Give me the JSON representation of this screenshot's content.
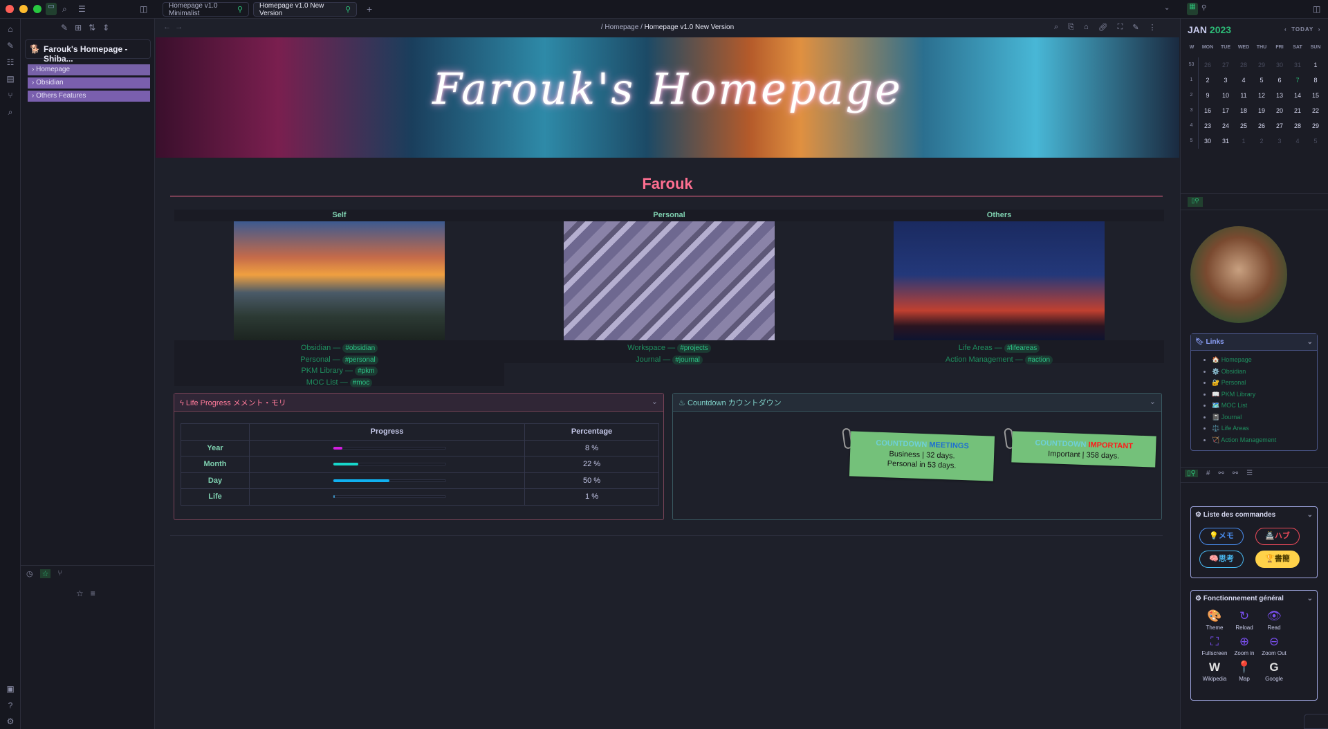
{
  "window": {
    "tabs": [
      {
        "label": "Homepage v1.0 Minimalist"
      },
      {
        "label": "Homepage v1.0 New Version"
      }
    ],
    "new_tab": "+"
  },
  "breadcrumb": {
    "sep": "/",
    "parent": "Homepage",
    "current": "Homepage v1.0 New Version"
  },
  "left_sidebar": {
    "vault_title": "Farouk's Homepage - Shiba...",
    "folders": [
      {
        "label": "Homepage"
      },
      {
        "label": "Obsidian"
      },
      {
        "label": "Others Features"
      }
    ]
  },
  "banner": {
    "text": "Farouk's Homepage"
  },
  "page": {
    "title": "Farouk",
    "columns": [
      {
        "header": "Self",
        "links": [
          {
            "label": "Obsidian",
            "tag": "#obsidian"
          },
          {
            "label": "Personal",
            "tag": "#personal"
          },
          {
            "label": "PKM Library",
            "tag": "#pkm"
          },
          {
            "label": "MOC List",
            "tag": "#moc"
          }
        ]
      },
      {
        "header": "Personal",
        "links": [
          {
            "label": "Workspace",
            "tag": "#projects"
          },
          {
            "label": "Journal",
            "tag": "#journal"
          }
        ]
      },
      {
        "header": "Others",
        "links": [
          {
            "label": "Life Areas",
            "tag": "#lifeareas"
          },
          {
            "label": "Action Management",
            "tag": "#action"
          }
        ]
      }
    ],
    "dash": "—",
    "life_progress": {
      "title": "Life Progress メメント・モリ",
      "headers": [
        "",
        "Progress",
        "Percentage"
      ],
      "rows": [
        {
          "label": "Year",
          "value": 8,
          "text": "8 %",
          "color": "#d21ee0"
        },
        {
          "label": "Month",
          "value": 22,
          "text": "22 %",
          "color": "#17d8cc"
        },
        {
          "label": "Day",
          "value": 50,
          "text": "50 %",
          "color": "#10b0f0"
        },
        {
          "label": "Life",
          "value": 1,
          "text": "1 %",
          "color": "#3a8fc0"
        }
      ]
    },
    "countdown": {
      "title": "Countdown カウントダウン",
      "notes": [
        {
          "prefix": "COUNTDOWN",
          "kind": "MEETINGS",
          "kind_color": "#1e6fd0",
          "lines": [
            "Business | 32 days.",
            "Personal in 53 days."
          ]
        },
        {
          "prefix": "COUNTDOWN",
          "kind": "IMPORTANT",
          "kind_color": "#ff1a1a",
          "lines": [
            "Important | 358 days."
          ]
        }
      ]
    }
  },
  "calendar": {
    "month": "JAN",
    "year": "2023",
    "today": "TODAY",
    "weekdays": [
      "W",
      "MON",
      "TUE",
      "WED",
      "THU",
      "FRI",
      "SAT",
      "SUN"
    ],
    "weeks": [
      [
        "53",
        "26",
        "27",
        "28",
        "29",
        "30",
        "31",
        "1"
      ],
      [
        "1",
        "2",
        "3",
        "4",
        "5",
        "6",
        "7",
        "8"
      ],
      [
        "2",
        "9",
        "10",
        "11",
        "12",
        "13",
        "14",
        "15"
      ],
      [
        "3",
        "16",
        "17",
        "18",
        "19",
        "20",
        "21",
        "22"
      ],
      [
        "4",
        "23",
        "24",
        "25",
        "26",
        "27",
        "28",
        "29"
      ],
      [
        "5",
        "30",
        "31",
        "1",
        "2",
        "3",
        "4",
        "5"
      ]
    ]
  },
  "links_box": {
    "title": "Links",
    "items": [
      {
        "icon": "🏠",
        "label": "Homepage"
      },
      {
        "icon": "⚙️",
        "label": "Obsidian"
      },
      {
        "icon": "🔐",
        "label": "Personal"
      },
      {
        "icon": "📖",
        "label": "PKM Library"
      },
      {
        "icon": "🗺️",
        "label": "MOC List"
      },
      {
        "icon": "📓",
        "label": "Journal"
      },
      {
        "icon": "⚖️",
        "label": "Life Areas"
      },
      {
        "icon": "🏹",
        "label": "Action Management"
      }
    ]
  },
  "commands": {
    "title": "Liste des commandes",
    "pills": [
      {
        "label": "💡メモ",
        "color": "#4a8ef0"
      },
      {
        "label": "🏯ハブ",
        "color": "#ee4a5a"
      },
      {
        "label": "🧠思考",
        "color": "#49b8f0"
      },
      {
        "label": "🏆書簡",
        "color": "#ffd24a"
      }
    ]
  },
  "general": {
    "title": "Fonctionnement général",
    "items": [
      {
        "icon": "🎨",
        "label": "Theme"
      },
      {
        "icon": "↻",
        "label": "Reload"
      },
      {
        "icon": "👁",
        "label": "Read"
      },
      {
        "icon": "⛶",
        "label": "Fullscreen"
      },
      {
        "icon": "⊕",
        "label": "Zoom in"
      },
      {
        "icon": "⊖",
        "label": "Zoom Out"
      },
      {
        "icon": "W",
        "label": "Wikipedia"
      },
      {
        "icon": "📍",
        "label": "Map"
      },
      {
        "icon": "G",
        "label": "Google"
      }
    ]
  }
}
